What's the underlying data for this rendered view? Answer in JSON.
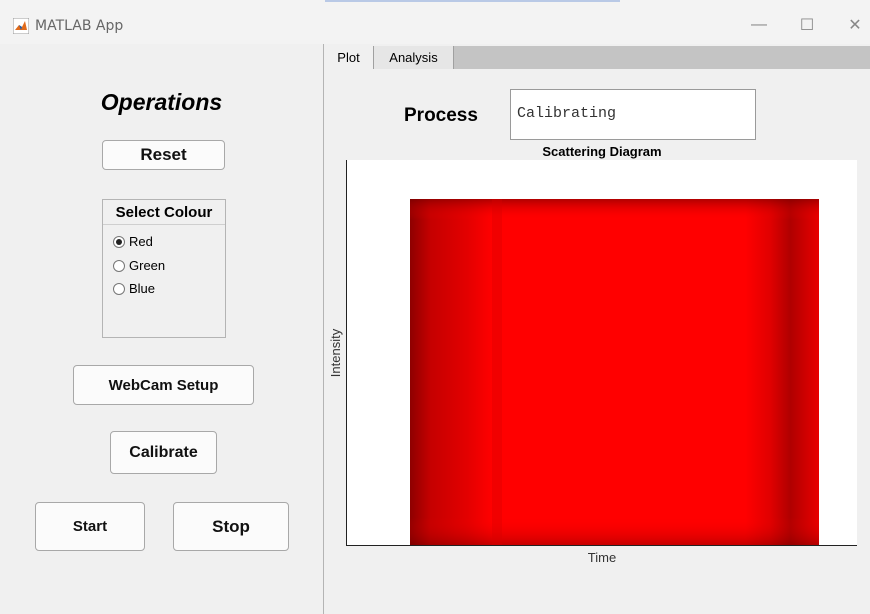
{
  "window": {
    "title": "MATLAB App",
    "minimize_glyph": "—",
    "maximize_glyph": "☐",
    "close_glyph": "✕"
  },
  "left": {
    "heading": "Operations",
    "reset_label": "Reset",
    "colour_group": {
      "title": "Select Colour",
      "options": [
        "Red",
        "Green",
        "Blue"
      ],
      "selected": "Red"
    },
    "webcam_label": "WebCam Setup",
    "calibrate_label": "Calibrate",
    "start_label": "Start",
    "stop_label": "Stop"
  },
  "tabs": [
    {
      "label": "Plot",
      "active": true
    },
    {
      "label": "Analysis",
      "active": false
    }
  ],
  "process": {
    "label": "Process",
    "value": "Calibrating"
  },
  "chart_data": {
    "type": "heatmap",
    "title": "Scattering Diagram",
    "xlabel": "Time",
    "ylabel": "Intensity",
    "colormap": "red",
    "accent_color": "#ff0000",
    "grid": false,
    "xticks": [],
    "yticks": []
  }
}
